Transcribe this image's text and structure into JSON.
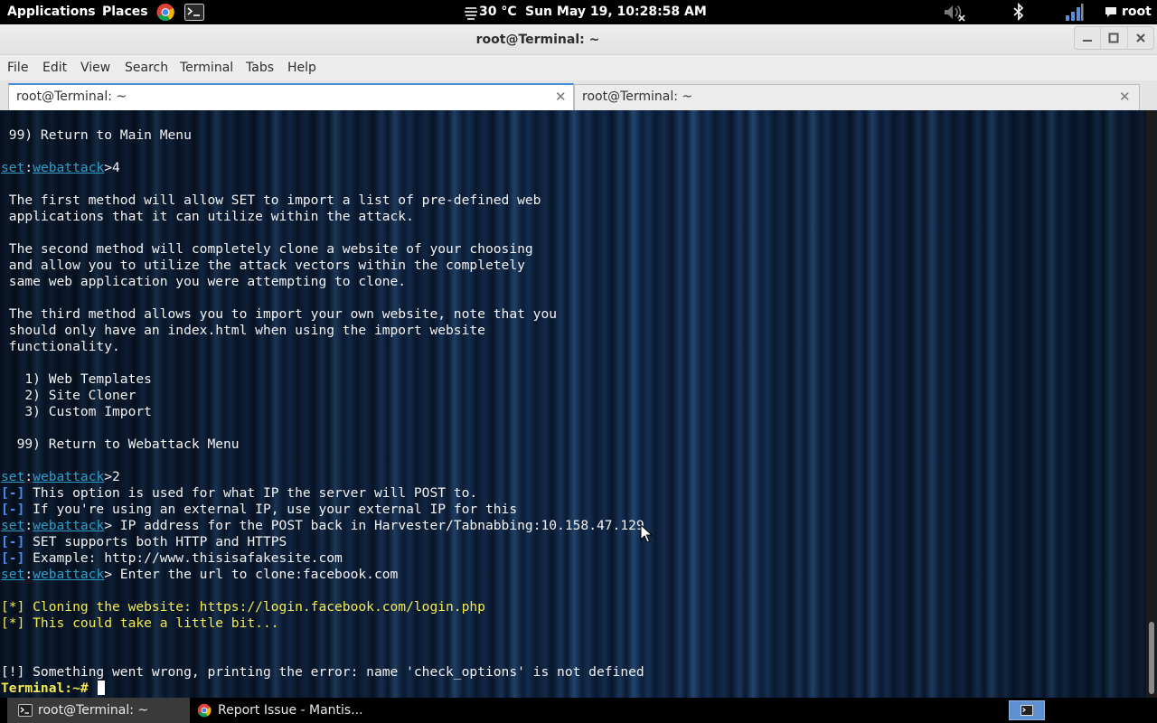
{
  "top_panel": {
    "applications": "Applications",
    "places": "Places",
    "launchers": [
      {
        "icon": "chrome-icon"
      },
      {
        "icon": "terminal-icon"
      }
    ],
    "weather": "30 °C",
    "weather_icon": "fog-icon",
    "clock": "Sun May 19, 10:28:58 AM",
    "status_icons": [
      "volume-muted-icon",
      "bluetooth-icon",
      "network-icon"
    ],
    "user": "root"
  },
  "window": {
    "title": "root@Terminal: ~"
  },
  "menubar": {
    "items": [
      "File",
      "Edit",
      "View",
      "Search",
      "Terminal",
      "Tabs",
      "Help"
    ]
  },
  "tabs": [
    {
      "label": "root@Terminal: ~",
      "active": true
    },
    {
      "label": "root@Terminal: ~",
      "active": false
    }
  ],
  "terminal": {
    "lines": [
      [
        {
          "t": " 99) Return to Main Menu"
        }
      ],
      [],
      [
        {
          "t": "set",
          "c": "set"
        },
        {
          "t": ":"
        },
        {
          "t": "webattack",
          "c": "set"
        },
        {
          "t": ">4"
        }
      ],
      [],
      [
        {
          "t": " The first method will allow SET to import a list of pre-defined web"
        }
      ],
      [
        {
          "t": " applications that it can utilize within the attack."
        }
      ],
      [],
      [
        {
          "t": " The second method will completely clone a website of your choosing"
        }
      ],
      [
        {
          "t": " and allow you to utilize the attack vectors within the completely"
        }
      ],
      [
        {
          "t": " same web application you were attempting to clone."
        }
      ],
      [],
      [
        {
          "t": " The third method allows you to import your own website, note that you"
        }
      ],
      [
        {
          "t": " should only have an index.html when using the import website"
        }
      ],
      [
        {
          "t": " functionality."
        }
      ],
      [],
      [
        {
          "t": "   1) Web Templates"
        }
      ],
      [
        {
          "t": "   2) Site Cloner"
        }
      ],
      [
        {
          "t": "   3) Custom Import"
        }
      ],
      [],
      [
        {
          "t": "  99) Return to Webattack Menu"
        }
      ],
      [],
      [
        {
          "t": "set",
          "c": "set"
        },
        {
          "t": ":"
        },
        {
          "t": "webattack",
          "c": "set"
        },
        {
          "t": ">2"
        }
      ],
      [
        {
          "t": "[-]",
          "c": "blue"
        },
        {
          "t": " This option is used for what IP the server will POST to."
        }
      ],
      [
        {
          "t": "[-]",
          "c": "blue"
        },
        {
          "t": " If you're using an external IP, use your external IP for this"
        }
      ],
      [
        {
          "t": "set",
          "c": "set"
        },
        {
          "t": ":"
        },
        {
          "t": "webattack",
          "c": "set"
        },
        {
          "t": "> IP address for the POST back in Harvester/Tabnabbing:10.158.47.129"
        }
      ],
      [
        {
          "t": "[-]",
          "c": "blue"
        },
        {
          "t": " SET supports both HTTP and HTTPS"
        }
      ],
      [
        {
          "t": "[-]",
          "c": "blue"
        },
        {
          "t": " Example: http://www.thisisafakesite.com"
        }
      ],
      [
        {
          "t": "set",
          "c": "set"
        },
        {
          "t": ":"
        },
        {
          "t": "webattack",
          "c": "set"
        },
        {
          "t": "> Enter the url to clone:facebook.com"
        }
      ],
      [],
      [
        {
          "t": "[*] Cloning the website: https://login.facebook.com/login.php",
          "c": "yel"
        }
      ],
      [
        {
          "t": "[*] This could take a little bit...",
          "c": "yel"
        }
      ],
      [],
      [],
      [
        {
          "t": "[!] Something went wrong, printing the error: name 'check_options' is not defined"
        }
      ],
      [
        {
          "t": "Terminal:~#",
          "c": "yelb"
        },
        {
          "t": " "
        },
        {
          "cursor": true
        }
      ]
    ]
  },
  "taskbar": {
    "tasks": [
      {
        "label": "root@Terminal: ~",
        "icon": "terminal-icon",
        "active": true
      },
      {
        "label": "Report Issue - Mantis...",
        "icon": "chrome-icon",
        "active": false
      }
    ],
    "workspace_icon": "terminal-icon"
  }
}
